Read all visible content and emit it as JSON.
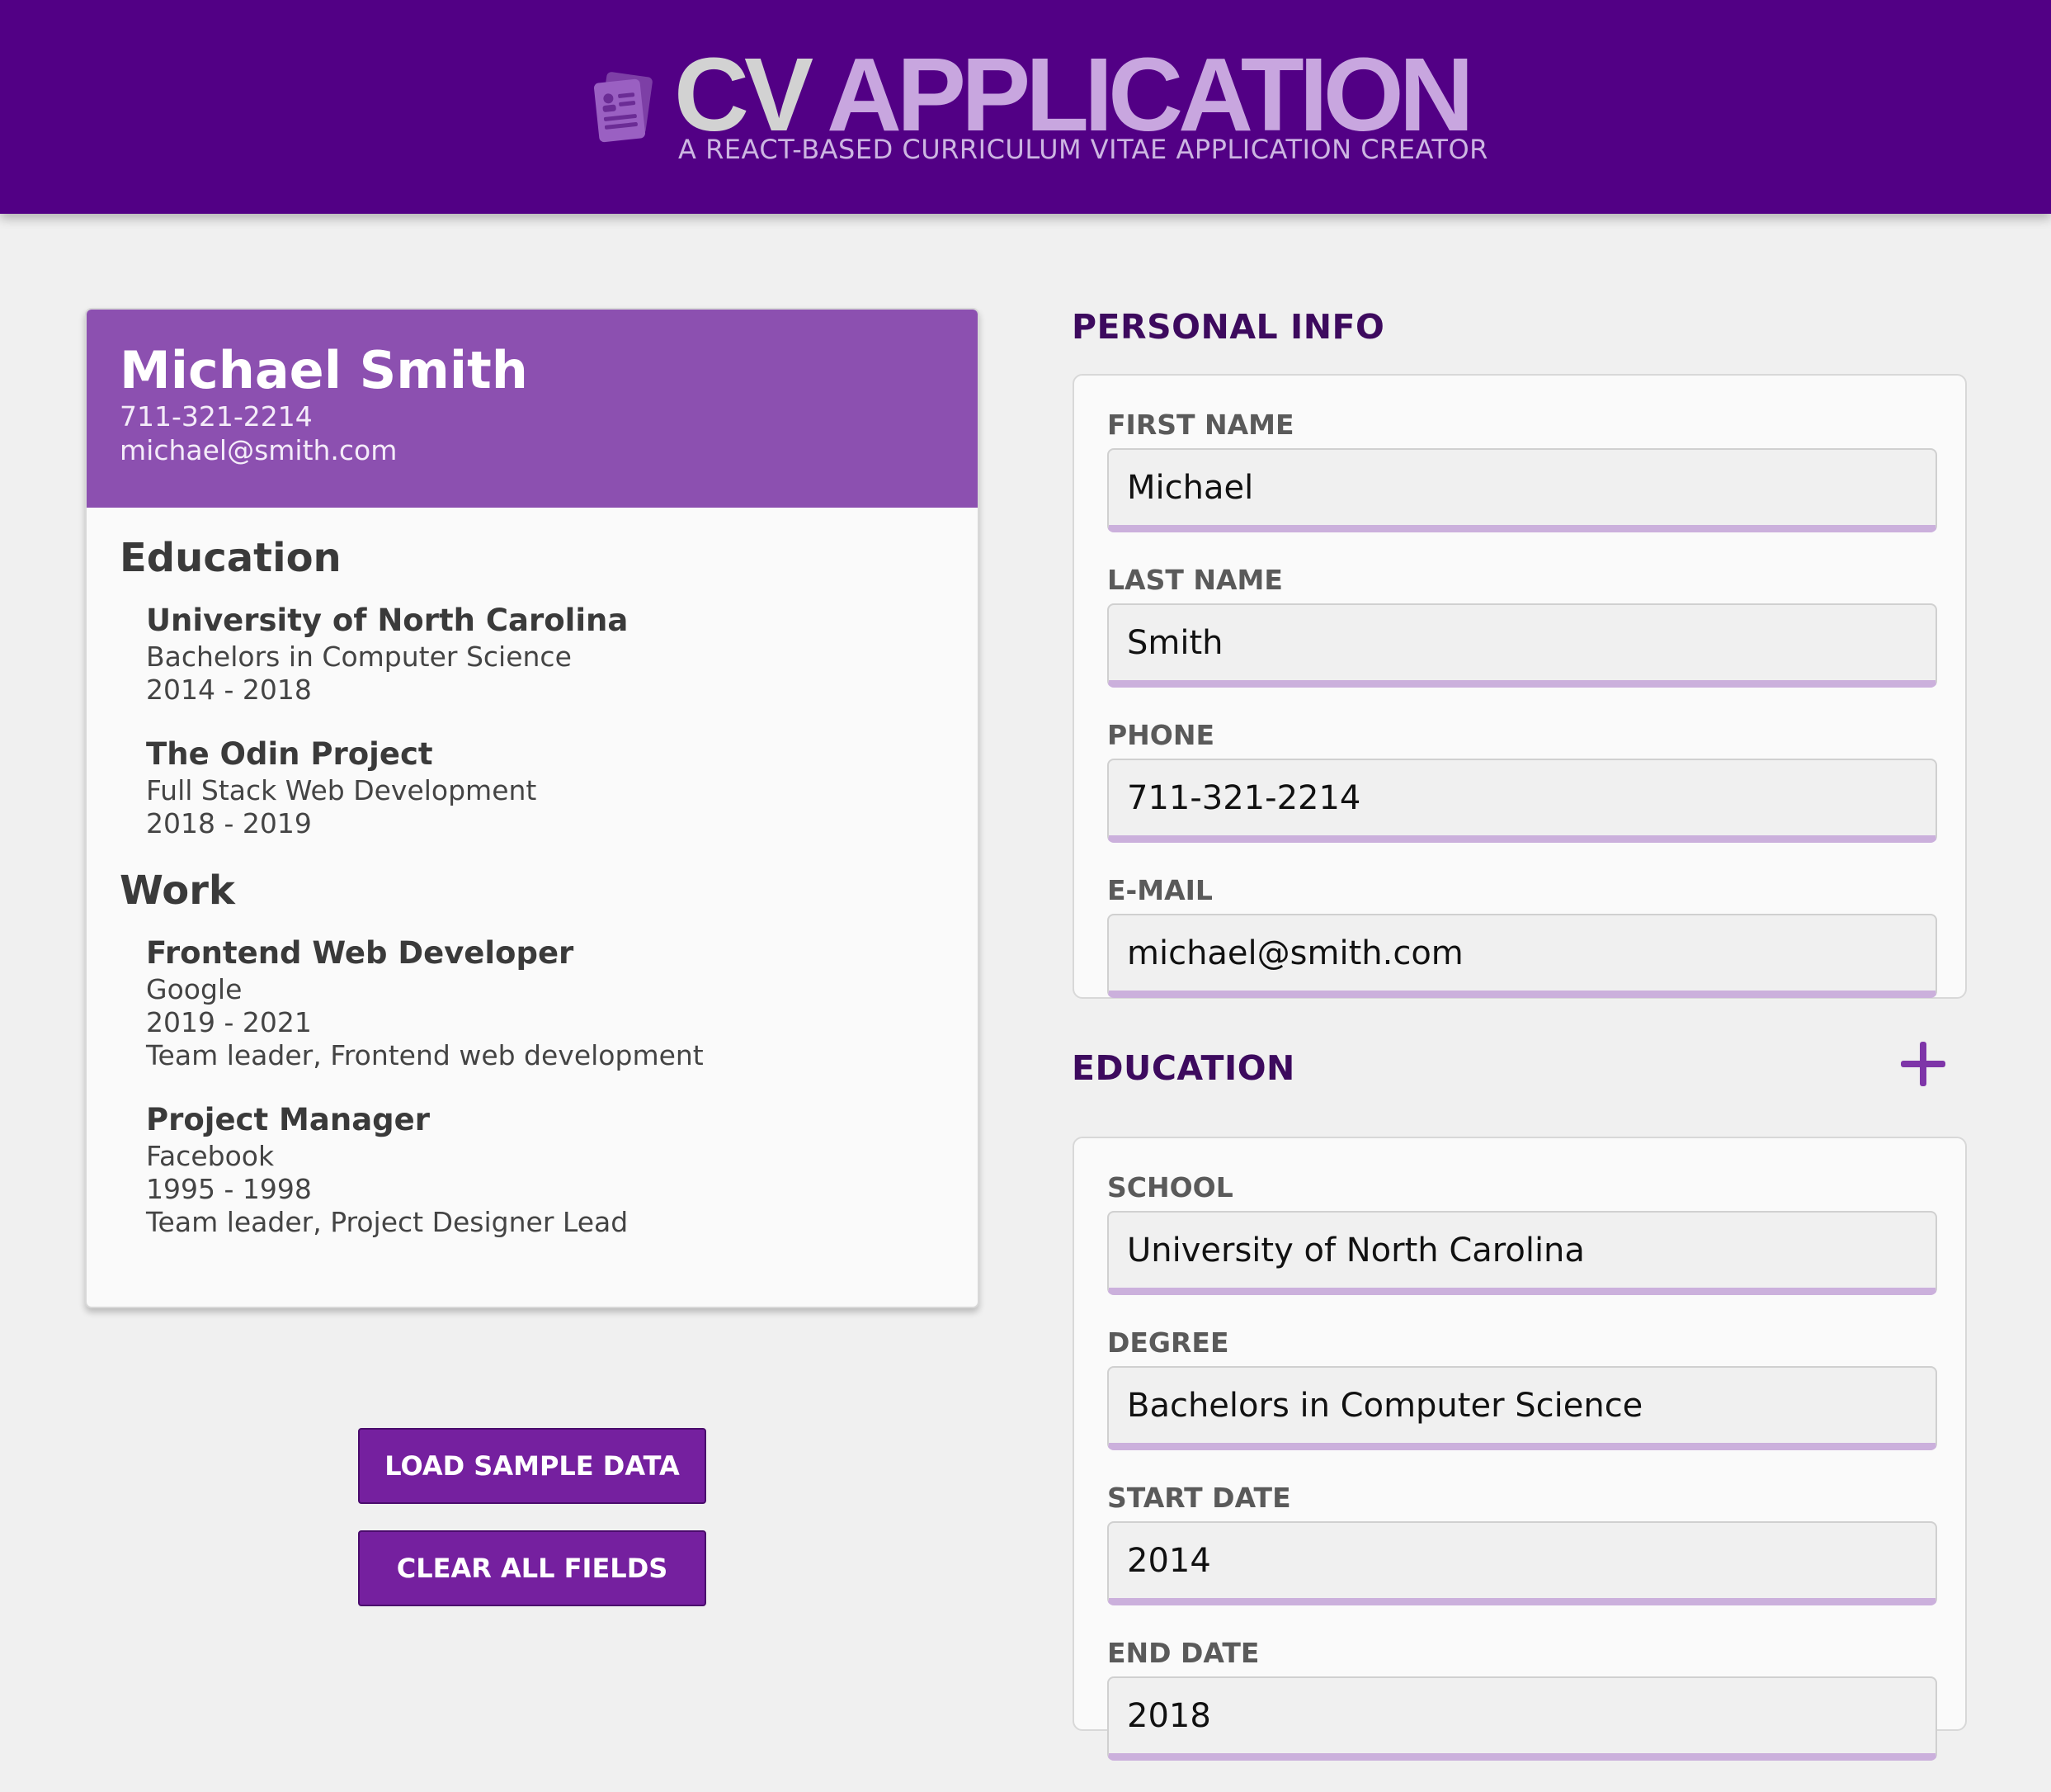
{
  "header": {
    "title_cv": "CV",
    "title_app": "APPLICATION",
    "subtitle": "A REACT-BASED CURRICULUM VITAE APPLICATION CREATOR",
    "icon": "resume-document-icon"
  },
  "preview": {
    "name": "Michael Smith",
    "phone": "711-321-2214",
    "email": "michael@smith.com",
    "education_heading": "Education",
    "education": [
      {
        "school": "University of North Carolina",
        "degree": "Bachelors in Computer Science",
        "dates": "2014 - 2018"
      },
      {
        "school": "The Odin Project",
        "degree": "Full Stack Web Development",
        "dates": "2018 - 2019"
      }
    ],
    "work_heading": "Work",
    "work": [
      {
        "position": "Frontend Web Developer",
        "company": "Google",
        "dates": "2019 - 2021",
        "description": "Team leader, Frontend web development"
      },
      {
        "position": "Project Manager",
        "company": "Facebook",
        "dates": "1995 - 1998",
        "description": "Team leader, Project Designer Lead"
      }
    ]
  },
  "buttons": {
    "load_sample": "LOAD SAMPLE DATA",
    "clear_all": "CLEAR ALL FIELDS"
  },
  "personal_info": {
    "title": "PERSONAL INFO",
    "fields": [
      {
        "label": "FIRST NAME",
        "value": "Michael"
      },
      {
        "label": "LAST NAME",
        "value": "Smith"
      },
      {
        "label": "PHONE",
        "value": "711-321-2214"
      },
      {
        "label": "E-MAIL",
        "value": "michael@smith.com"
      }
    ]
  },
  "education_form": {
    "title": "EDUCATION",
    "add_icon": "plus-icon",
    "fields": [
      {
        "label": "SCHOOL",
        "value": "University of North Carolina"
      },
      {
        "label": "DEGREE",
        "value": "Bachelors in Computer Science"
      },
      {
        "label": "START DATE",
        "value": "2014"
      },
      {
        "label": "END DATE",
        "value": "2018"
      }
    ]
  },
  "colors": {
    "header_bg": "#520085",
    "preview_header_bg": "#8c50b0",
    "button_bg": "#75209f",
    "section_title": "#3d0a5e",
    "input_underline": "#cbb0dc"
  }
}
